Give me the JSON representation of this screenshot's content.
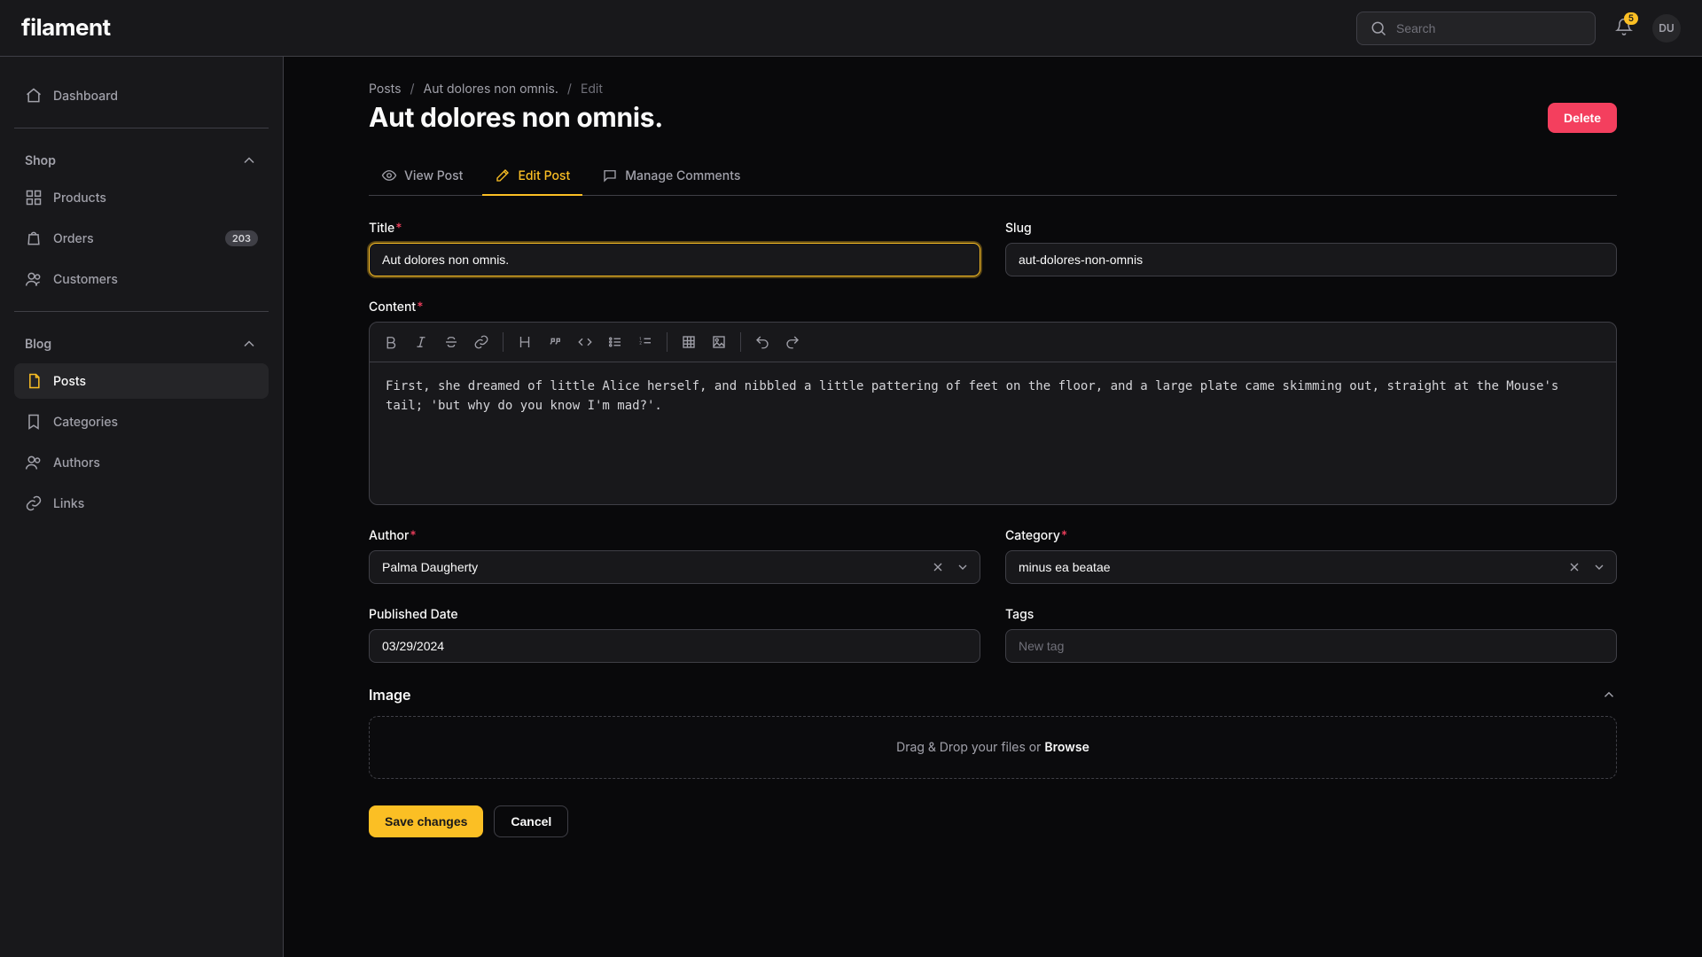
{
  "topbar": {
    "logo_text": "filament",
    "search_placeholder": "Search",
    "notification_count": "5",
    "avatar_initials": "DU"
  },
  "sidebar": {
    "dashboard_label": "Dashboard",
    "shop_label": "Shop",
    "products_label": "Products",
    "orders_label": "Orders",
    "orders_badge": "203",
    "customers_label": "Customers",
    "blog_label": "Blog",
    "posts_label": "Posts",
    "categories_label": "Categories",
    "authors_label": "Authors",
    "links_label": "Links"
  },
  "breadcrumb": {
    "item1": "Posts",
    "item2": "Aut dolores non omnis.",
    "item3": "Edit"
  },
  "page": {
    "title": "Aut dolores non omnis.",
    "delete_label": "Delete"
  },
  "tabs": {
    "view_label": "View Post",
    "edit_label": "Edit Post",
    "comments_label": "Manage Comments"
  },
  "form": {
    "title_label": "Title",
    "title_value": "Aut dolores non omnis.",
    "slug_label": "Slug",
    "slug_value": "aut-dolores-non-omnis",
    "content_label": "Content",
    "content_value": "First, she dreamed of little Alice herself, and nibbled a little pattering of feet on the floor, and a large plate came skimming out, straight at the Mouse's tail; 'but why do you know I'm mad?'.",
    "author_label": "Author",
    "author_value": "Palma Daugherty",
    "category_label": "Category",
    "category_value": "minus ea beatae",
    "published_label": "Published Date",
    "published_value": "03/29/2024",
    "tags_label": "Tags",
    "tags_placeholder": "New tag",
    "image_section_label": "Image",
    "dropzone_prefix": "Drag & Drop your files or ",
    "dropzone_browse": "Browse",
    "save_label": "Save changes",
    "cancel_label": "Cancel"
  }
}
